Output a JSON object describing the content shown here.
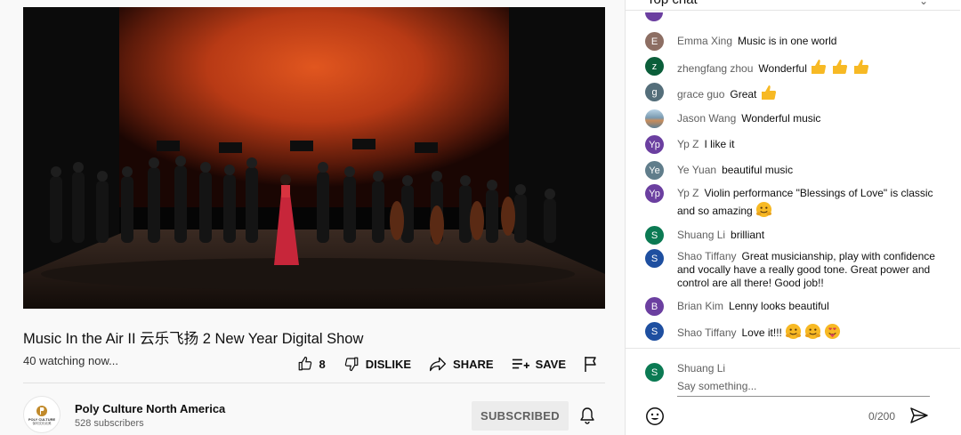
{
  "video": {
    "title": "Music In the Air II 云乐飞扬 2 New Year Digital Show",
    "watching": "40 watching now...",
    "actions": {
      "like_count": "8",
      "dislike_label": "DISLIKE",
      "share_label": "SHARE",
      "save_label": "SAVE"
    }
  },
  "channel": {
    "name": "Poly Culture North America",
    "subscribers": "528 subscribers",
    "subscribe_state": "SUBSCRIBED",
    "logo_text": "POLY CULTURE",
    "logo_subtext": "保利文化北美"
  },
  "chat": {
    "header": "Top chat",
    "messages": [
      {
        "initial": "E",
        "author": "Emma Xing",
        "text": "Music is in one world",
        "color": "#8d6e63"
      },
      {
        "initial": "z",
        "author": "zhengfang zhou",
        "text": "Wonderful",
        "emojis": "thumbs-up x3",
        "color": "#0b5e3a"
      },
      {
        "initial": "g",
        "author": "grace guo",
        "text": "Great",
        "emojis": "thumbs-up x1",
        "color": "#546e7a"
      },
      {
        "initial": "",
        "author": "Jason Wang",
        "text": "Wonderful music",
        "color": "#7a9ab0"
      },
      {
        "initial": "Yp",
        "author": "Yp Z",
        "text": "I like it",
        "color": "#6b3fa0"
      },
      {
        "initial": "Ye",
        "author": "Ye Yuan",
        "text": "beautiful music",
        "color": "#607d8b"
      },
      {
        "initial": "Yp",
        "author": "Yp Z",
        "text": "Violin performance \"Blessings of Love\" is classic and so amazing",
        "emojis": "hug-face x1",
        "color": "#6b3fa0"
      },
      {
        "initial": "S",
        "author": "Shuang Li",
        "text": "brilliant",
        "color": "#0b7a53"
      },
      {
        "initial": "S",
        "author": "Shao Tiffany",
        "text": "Great musicianship, play with confidence and vocally have a really good tone. Great power and control are all there! Good job!!",
        "color": "#1e4fa0"
      },
      {
        "initial": "B",
        "author": "Brian Kim",
        "text": "Lenny looks beautiful",
        "color": "#6b3fa0"
      },
      {
        "initial": "S",
        "author": "Shao Tiffany",
        "text": "Love it!!!",
        "emojis": "hug-face x2, heart-face x1",
        "color": "#1e4fa0"
      }
    ],
    "input": {
      "user_initial": "S",
      "user_name": "Shuang Li",
      "placeholder": "Say something...",
      "counter": "0/200"
    }
  },
  "colors": {
    "accent": "#0f0f0f",
    "secondary_text": "#606060",
    "emoji_yellow": "#f7b924"
  }
}
